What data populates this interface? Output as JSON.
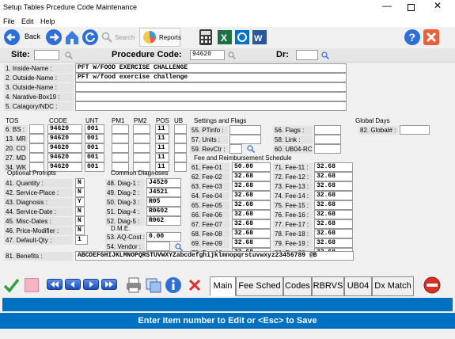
{
  "window": {
    "title": "Setup Tables  Prcedure  Code  Maintenance"
  },
  "menu": {
    "file": "File",
    "edit": "Edit",
    "help": "Help"
  },
  "toolbar": {
    "back": "Back",
    "search": "Search",
    "reports": "Reports"
  },
  "header": {
    "site_label": "Site:",
    "site_value": "",
    "proc_label": "Procedure Code:",
    "proc_value": "94620",
    "dr_label": "Dr:",
    "dr_value": ""
  },
  "names": [
    {
      "label": "1. Inside-Name :",
      "value": "PFT W/FOOD EXERCISE CHALLENGE"
    },
    {
      "label": "2. Outside-Name :",
      "value": "PFT w/food exercise challenge"
    },
    {
      "label": "3. Outside-Name :",
      "value": ""
    },
    {
      "label": "4. Narative-Box19 :",
      "value": ""
    },
    {
      "label": "5. Catagory/NDC :",
      "value": ""
    }
  ],
  "tos_headers": {
    "tos": "TOS",
    "code": "CODE",
    "unt": "UNT",
    "pm1": "PM1",
    "pm2": "PM2",
    "pos": "POS",
    "ub": "UB"
  },
  "tos_rows": [
    {
      "label": "6. BS :",
      "tos": "",
      "code": "94620",
      "unt": "001",
      "pm1": "",
      "pm2": "",
      "pos": "11",
      "ub": ""
    },
    {
      "label": "13. MR :",
      "tos": "",
      "code": "94620",
      "unt": "001",
      "pm1": "",
      "pm2": "",
      "pos": "11",
      "ub": ""
    },
    {
      "label": "20. CO :",
      "tos": "",
      "code": "94620",
      "unt": "001",
      "pm1": "",
      "pm2": "",
      "pos": "11",
      "ub": ""
    },
    {
      "label": "27. MD :",
      "tos": "",
      "code": "94620",
      "unt": "001",
      "pm1": "",
      "pm2": "",
      "pos": "11",
      "ub": ""
    },
    {
      "label": "34. WK :",
      "tos": "",
      "code": "94620",
      "unt": "001",
      "pm1": "",
      "pm2": "",
      "pos": "11",
      "ub": ""
    }
  ],
  "settings": {
    "title": "Settings and Flags",
    "items": [
      {
        "label": "55. PTinfo :",
        "value": ""
      },
      {
        "label": "57. Units :",
        "value": ""
      },
      {
        "label": "59. RevCtr :",
        "value": ""
      }
    ],
    "right": [
      {
        "label": "56. Flags :",
        "value": ""
      },
      {
        "label": "58. Link :",
        "value": ""
      },
      {
        "label": "60. UB04-RC :",
        "value": ""
      }
    ]
  },
  "global_days": {
    "title": "Global Days",
    "label": "82. Global# :",
    "value": ""
  },
  "fees": {
    "title": "Fee and Reimbursement Schedule",
    "left": [
      {
        "label": "61. Fee-01",
        "value": "50.00"
      },
      {
        "label": "62. Fee-02",
        "value": "32.68"
      },
      {
        "label": "63. Fee-03",
        "value": "32.68"
      },
      {
        "label": "64. Fee-04",
        "value": "32.68"
      },
      {
        "label": "65. Fee-05",
        "value": "32.68"
      },
      {
        "label": "66. Fee-06",
        "value": "32.68"
      },
      {
        "label": "67. Fee-07",
        "value": "32.68"
      },
      {
        "label": "68. Fee-08",
        "value": "32.68"
      },
      {
        "label": "69. Fee-09",
        "value": "32.68"
      },
      {
        "label": "70. Fee-10",
        "value": "32.68"
      }
    ],
    "right": [
      {
        "label": "71. Fee-11 :",
        "value": "32.68"
      },
      {
        "label": "72. Fee-12 :",
        "value": "32.68"
      },
      {
        "label": "73. Fee-13 :",
        "value": "32.68"
      },
      {
        "label": "74. Fee-14 :",
        "value": "32.68"
      },
      {
        "label": "75. Fee-15 :",
        "value": "32.68"
      },
      {
        "label": "76. Fee-16 :",
        "value": "32.68"
      },
      {
        "label": "77. Fee-17 :",
        "value": "32.68"
      },
      {
        "label": "78. Fee-18 :",
        "value": "32.68"
      },
      {
        "label": "79. Fee-19 :",
        "value": "32.68"
      },
      {
        "label": "80. Fee-20 :",
        "value": "32.68"
      }
    ]
  },
  "optional": {
    "title": "Optional Prompts",
    "items": [
      {
        "label": "41. Quantity :",
        "value": "N"
      },
      {
        "label": "42. Service-Place :",
        "value": "N"
      },
      {
        "label": "43. Diagnosis :",
        "value": "Y"
      },
      {
        "label": "44. Service-Date :",
        "value": "N"
      },
      {
        "label": "45. Misc-Dates :",
        "value": "N"
      },
      {
        "label": "46. Price-Modifier :",
        "value": "N"
      },
      {
        "label": "47. Default-Qty :",
        "value": "1"
      }
    ]
  },
  "diagnoses": {
    "title": "Common Diagnoses",
    "items": [
      {
        "label": "48. Diag-1 :",
        "value": "J4520"
      },
      {
        "label": "49. Diag-2 :",
        "value": "J4521"
      },
      {
        "label": "50. Diag-3 :",
        "value": "R05"
      },
      {
        "label": "51. Diag-4 :",
        "value": "R0602"
      },
      {
        "label": "52. Diag-5 :",
        "value": "R062"
      }
    ]
  },
  "dme": {
    "title": "D.M.E.",
    "items": [
      {
        "label": "53. AQ-Cost :",
        "value": "0.00"
      },
      {
        "label": "54. Vendor :",
        "value": ""
      }
    ]
  },
  "benefits": {
    "label": "81. Benefits :",
    "value": "ABCDEFGHIJKLMNOPQRSTUVWXYZabcdefghijklmnopqrstuvwxyz23456789 @B"
  },
  "tabs": [
    "Main",
    "Fee Sched",
    "Codes",
    "RBRVS",
    "UB04",
    "Dx Match"
  ],
  "status": "Enter Item number to Edit or <Esc> to Save",
  "colors": {
    "statusbar": "#0070c0",
    "titlebar": "#ffffff",
    "field_bg": "#ffffff",
    "label_bg": "#e3e3e3"
  },
  "icons": [
    "back-arrow-icon",
    "forward-arrow-icon",
    "home-icon",
    "refresh-icon",
    "search-icon",
    "reports-icon",
    "calculator-icon",
    "excel-icon",
    "outlook-icon",
    "word-icon",
    "help-icon",
    "close-icon",
    "checkmark-icon",
    "eraser-icon",
    "first-icon",
    "prev-icon",
    "next-icon",
    "last-icon",
    "print-icon",
    "copy-icon",
    "info-icon",
    "delete-icon",
    "exit-icon"
  ]
}
